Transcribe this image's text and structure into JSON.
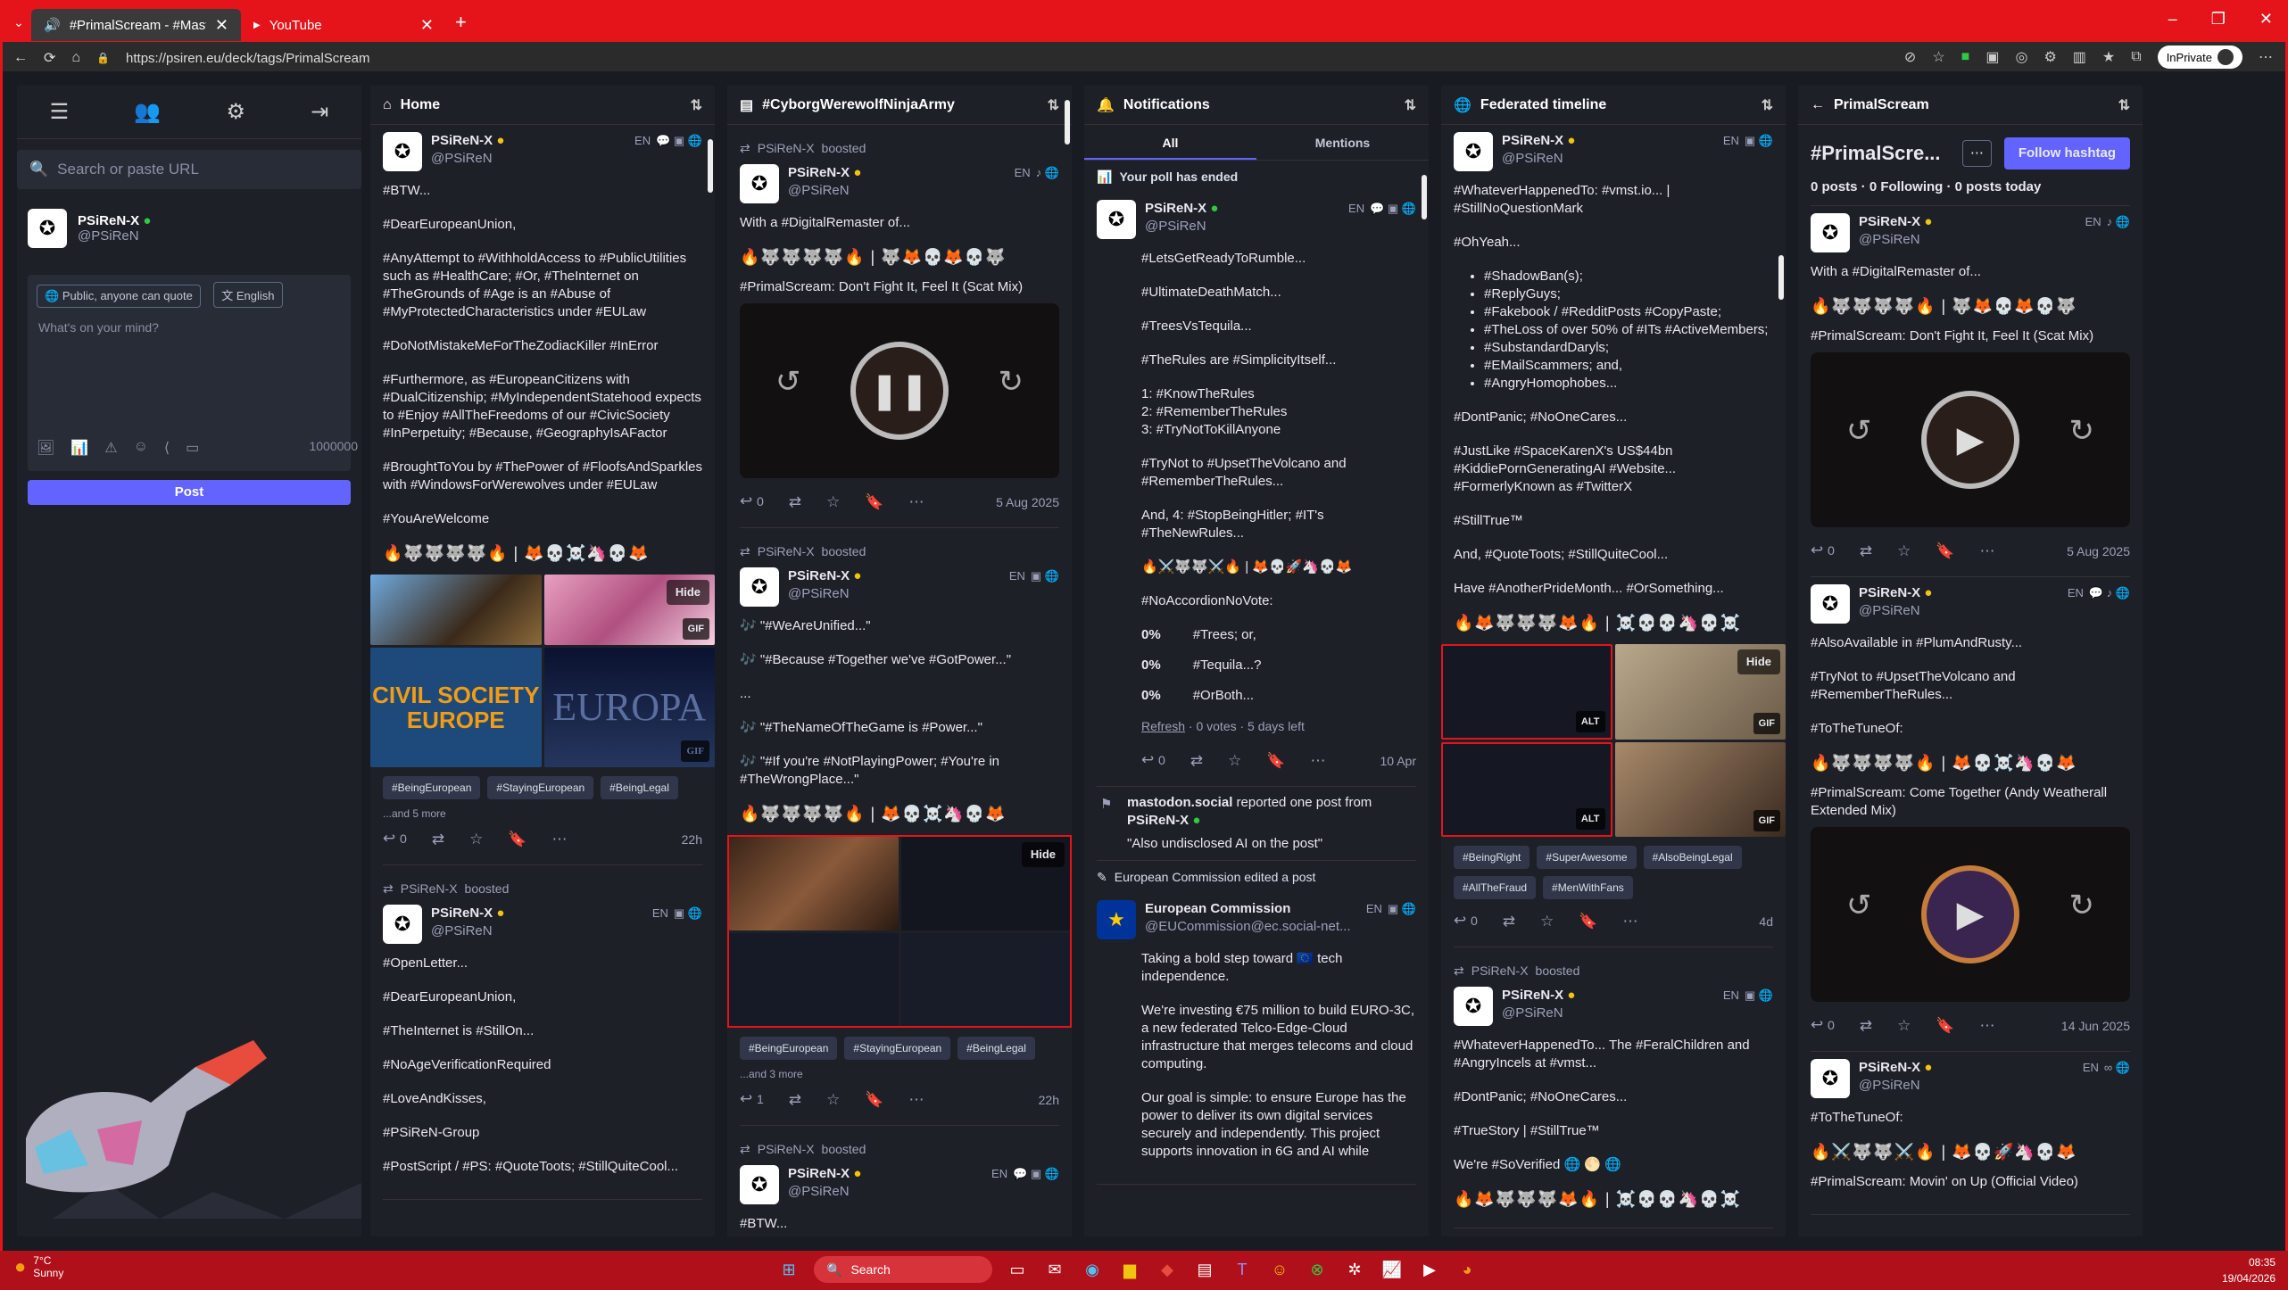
{
  "browser": {
    "tabs": [
      {
        "label": "#PrimalScream - #Mastodon...",
        "active": true
      },
      {
        "label": "YouTube",
        "active": false
      }
    ],
    "url": "https://psiren.eu/deck/tags/PrimalScream",
    "inprivate": "InPrivate",
    "accent": "#e5141b"
  },
  "compose": {
    "search_placeholder": "Search or paste URL",
    "account": {
      "name": "PSiReN-X",
      "handle": "@PSiReN"
    },
    "visibility": "Public, anyone can quote",
    "language": "English",
    "placeholder": "What's on your mind?",
    "char_count": "1000000",
    "post_label": "Post"
  },
  "columns": {
    "home": {
      "title": "Home",
      "post1": {
        "name": "PSiReN-X",
        "handle": "@PSiReN",
        "lang": "EN",
        "paras": [
          "#BTW...",
          "#DearEuropeanUnion,",
          "#AnyAttempt to #WithholdAccess to #PublicUtilities such as #HealthCare; #Or, #TheInternet on #TheGrounds of #Age is an #Abuse of #MyProtectedCharacteristics under #EULaw",
          "#DoNotMistakeMeForTheZodiacKiller #InError",
          "#Furthermore, as #EuropeanCitizens with #DualCitizenship; #MyIndependentStatehood expects to #Enjoy #AllTheFreedoms of our #CivicSociety #InPerpetuity; #Because, #GeographyIsAFactor",
          "#BroughtToYou by #ThePower of #FloofsAndSparkles with #WindowsForWerewolves under #EULaw",
          "#YouAreWelcome"
        ],
        "emojis": "🔥🐺🐺🐺🐺🔥 | 🦊💀☠️🦄💀🦊",
        "hide": "Hide",
        "gif": "GIF",
        "media_text": "CIVIL SOCIETY EUROPE",
        "media_text2": "EUROPA",
        "tags": [
          "#BeingEuropean",
          "#StayingEuropean",
          "#BeingLegal"
        ],
        "more": "...and 5 more",
        "replies": "0",
        "time": "22h"
      },
      "post2": {
        "booster": "PSiReN-X",
        "boosted": "boosted",
        "name": "PSiReN-X",
        "handle": "@PSiReN",
        "lang": "EN",
        "paras": [
          "#OpenLetter...",
          "#DearEuropeanUnion,",
          "#TheInternet is #StillOn...",
          "#NoAgeVerificationRequired",
          "#LoveAndKisses,",
          "#PSiReN-Group",
          "#PostScript / #PS: #QuoteToots; #StillQuiteCool..."
        ]
      }
    },
    "cyborg": {
      "title": "#CyborgWerewolfNinjaArmy",
      "post1": {
        "booster": "PSiReN-X",
        "boosted": "boosted",
        "name": "PSiReN-X",
        "handle": "@PSiReN",
        "lang": "EN",
        "text": "With a #DigitalRemaster of...",
        "emojis": "🔥🐺🐺🐺🐺🔥 | 🐺🦊💀🦊💀🐺",
        "title": "#PrimalScream: Don't Fight It, Feel It (Scat Mix)",
        "replies": "0",
        "time": "5 Aug 2025"
      },
      "post2": {
        "booster": "PSiReN-X",
        "boosted": "boosted",
        "name": "PSiReN-X",
        "handle": "@PSiReN",
        "lang": "EN",
        "paras": [
          "🎶 \"#WeAreUnified...\"",
          "🎶 \"#Because #Together we've #GotPower...\"",
          "...",
          "🎶 \"#TheNameOfTheGame is #Power...\"",
          "🎶 \"#If you're #NotPlayingPower; #You're in #TheWrongPlace...\""
        ],
        "emojis": "🔥🐺🐺🐺🐺🔥 | 🦊💀☠️🦄💀🦊",
        "hide": "Hide",
        "tags": [
          "#BeingEuropean",
          "#StayingEuropean",
          "#BeingLegal"
        ],
        "more": "...and 3 more",
        "replies": "1",
        "time": "22h"
      },
      "post3": {
        "booster": "PSiReN-X",
        "boosted": "boosted",
        "name": "PSiReN-X",
        "handle": "@PSiReN",
        "lang": "EN",
        "text": "#BTW..."
      }
    },
    "notifications": {
      "title": "Notifications",
      "tab_all": "All",
      "tab_mentions": "Mentions",
      "poll_ended": "Your poll has ended",
      "post": {
        "name": "PSiReN-X",
        "handle": "@PSiReN",
        "lang": "EN",
        "paras": [
          "#LetsGetReadyToRumble...",
          "#UltimateDeathMatch...",
          "#TreesVsTequila...",
          "#TheRules are #SimplicityItself...",
          "1: #KnowTheRules\n2: #RememberTheRules\n3: #TryNotToKillAnyone",
          "#TryNot to #UpsetTheVolcano and #RememberTheRules...",
          "And, 4: #StopBeingHitler; #IT's #TheNewRules...",
          "🔥⚔️🐺🐺⚔️🔥 | 🦊💀🚀🦄💀🦊",
          "#NoAccordionNoVote:"
        ],
        "poll": [
          {
            "pct": "0%",
            "label": "#Trees; or,"
          },
          {
            "pct": "0%",
            "label": "#Tequila...?"
          },
          {
            "pct": "0%",
            "label": "#OrBoth..."
          }
        ],
        "refresh": "Refresh",
        "votes": " · 0 votes · 5 days left",
        "replies": "0",
        "time": "10 Apr"
      },
      "report": {
        "server": "mastodon.social",
        "text": " reported one post from",
        "name": "PSiReN-X",
        "quote": "\"Also undisclosed AI on the post\""
      },
      "edit": {
        "text": "European Commission edited a post"
      },
      "ec": {
        "name": "European Commission",
        "handle": "@EUCommission@ec.social-net...",
        "lang": "EN",
        "paras": [
          "Taking a bold step toward 🇪🇺 tech independence.",
          "We're investing €75 million to build EURO-3C, a new federated Telco-Edge-Cloud infrastructure that merges telecoms and cloud computing.",
          "Our goal is simple: to ensure Europe has the power to deliver its own digital services securely and independently. This project supports innovation in 6G and AI while"
        ]
      }
    },
    "federated": {
      "title": "Federated timeline",
      "post1": {
        "name": "PSiReN-X",
        "handle": "@PSiReN",
        "lang": "EN",
        "p1": "#WhateverHappenedTo: #vmst.io... | #StillNoQuestionMark",
        "p2": "#OhYeah...",
        "bullets": [
          "#ShadowBan(s);",
          "#ReplyGuys;",
          "#Fakebook / #RedditPosts #CopyPaste;",
          "#TheLoss of over 50% of #ITs #ActiveMembers;",
          "#SubstandardDaryls;",
          "#EMailScammers; and,",
          "#AngryHomophobes..."
        ],
        "paras": [
          "#DontPanic; #NoOneCares...",
          "#JustLike #SpaceKarenX's US$44bn #KiddiePornGeneratingAI #Website... #FormerlyKnown as #TwitterX",
          "#StillTrue™",
          "And, #QuoteToots; #StillQuiteCool...",
          "Have #AnotherPrideMonth... #OrSomething..."
        ],
        "emojis": "🔥🦊🐺🐺🐺🦊🔥 | ☠️💀💀🦄💀☠️",
        "hide": "Hide",
        "alt": "ALT",
        "gif": "GIF",
        "tags": [
          "#BeingRight",
          "#SuperAwesome",
          "#AlsoBeingLegal",
          "#AllTheFraud",
          "#MenWithFans"
        ],
        "replies": "0",
        "time": "4d"
      },
      "post2": {
        "booster": "PSiReN-X",
        "boosted": "boosted",
        "name": "PSiReN-X",
        "handle": "@PSiReN",
        "lang": "EN",
        "paras": [
          "#WhateverHappenedTo... The #FeralChildren and #AngryIncels at #vmst...",
          "#DontPanic; #NoOneCares...",
          "#TrueStory | #StillTrue™",
          "We're #SoVerified 🌐 🌕 🌐"
        ],
        "emojis": "🔥🦊🐺🐺🐺🦊🔥 | ☠️💀💀🦄💀☠️"
      }
    },
    "primal": {
      "title": "PrimalScream",
      "hashtag": "#PrimalScre...",
      "follow": "Follow hashtag",
      "stats": "0 posts · 0 Following · 0 posts today",
      "post1": {
        "name": "PSiReN-X",
        "handle": "@PSiReN",
        "lang": "EN",
        "text": "With a #DigitalRemaster of...",
        "emojis": "🔥🐺🐺🐺🐺🔥 | 🐺🦊💀🦊💀🐺",
        "title": "#PrimalScream: Don't Fight It, Feel It (Scat Mix)",
        "replies": "0",
        "time": "5 Aug 2025"
      },
      "post2": {
        "name": "PSiReN-X",
        "handle": "@PSiReN",
        "lang": "EN",
        "paras": [
          "#AlsoAvailable in #PlumAndRusty...",
          "#TryNot to #UpsetTheVolcano and #RememberTheRules...",
          "#ToTheTuneOf:"
        ],
        "emojis": "🔥🐺🐺🐺🐺🔥 | 🦊💀☠️🦄💀🦊",
        "title": "#PrimalScream: Come Together (Andy Weatherall Extended Mix)",
        "replies": "0",
        "time": "14 Jun 2025"
      },
      "post3": {
        "name": "PSiReN-X",
        "handle": "@PSiReN",
        "lang": "EN",
        "paras": [
          "#ToTheTuneOf:"
        ],
        "emojis": "🔥⚔️🐺🐺⚔️🔥 | 🦊💀🚀🦄💀🦊",
        "title": "#PrimalScream: Movin' on Up (Official Video)"
      }
    }
  },
  "taskbar": {
    "temp": "7°C",
    "weather": "Sunny",
    "search": "Search",
    "time": "08:35",
    "date": "19/04/2026"
  }
}
